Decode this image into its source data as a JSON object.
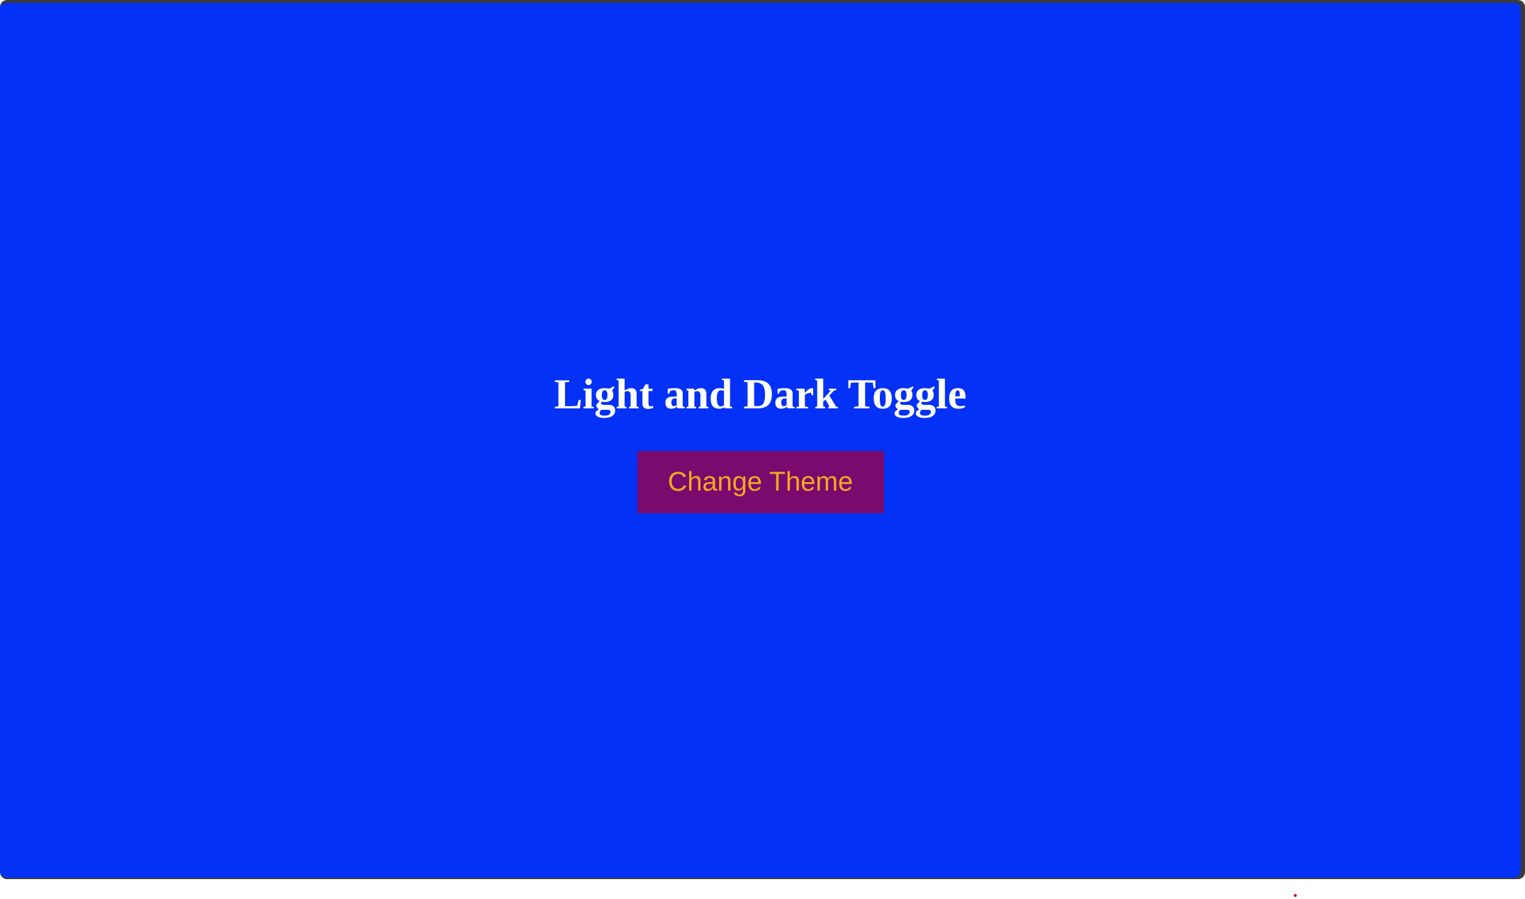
{
  "page": {
    "title": "Light and Dark Toggle"
  },
  "controls": {
    "change_theme_label": "Change Theme"
  },
  "colors": {
    "background": "#0331f6",
    "title_text": "#ffffff",
    "button_background": "#7a0a6e",
    "button_text": "#f5a623",
    "window_frame": "#3a3a3a",
    "indicator_dot": "#d0021b"
  }
}
